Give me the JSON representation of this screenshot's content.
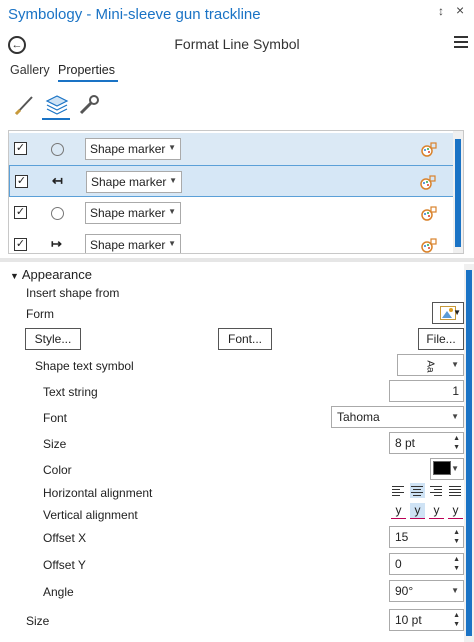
{
  "window": {
    "title": "Symbology - Mini-sleeve gun trackline",
    "pin_glyph": "↕",
    "close_glyph": "×"
  },
  "header": {
    "title": "Format Line Symbol",
    "back_glyph": "←"
  },
  "tabs": {
    "gallery": "Gallery",
    "properties": "Properties"
  },
  "layers": [
    {
      "checked": true,
      "marker_kind": "circle",
      "type": "Shape marker",
      "state": "selected"
    },
    {
      "checked": true,
      "marker_kind": "tick",
      "marker_glyph": "↤",
      "type": "Shape marker",
      "state": "active"
    },
    {
      "checked": true,
      "marker_kind": "circle",
      "type": "Shape marker",
      "state": "normal"
    },
    {
      "checked": true,
      "marker_kind": "tick",
      "marker_glyph": "↦",
      "type": "Shape marker",
      "state": "normal"
    }
  ],
  "appearance": {
    "section_title": "Appearance",
    "insert_shape_from": "Insert shape from",
    "form_label": "Form",
    "style_btn": "Style...",
    "font_btn": "Font...",
    "file_btn": "File...",
    "shape_text_symbol": "Shape text symbol",
    "shape_text_value": "Aa",
    "text_string_label": "Text string",
    "text_string_value": "1",
    "font_label": "Font",
    "font_value": "Tahoma",
    "size_label": "Size",
    "size_value": "8 pt",
    "color_label": "Color",
    "color_value": "#000000",
    "halign_label": "Horizontal alignment",
    "valign_label": "Vertical alignment",
    "valign_glyph": "y",
    "offset_x_label": "Offset X",
    "offset_x_value": "15",
    "offset_y_label": "Offset Y",
    "offset_y_value": "0",
    "angle_label": "Angle",
    "angle_value": "90°",
    "outer_size_label": "Size",
    "outer_size_value": "10 pt"
  },
  "colors": {
    "accent": "#1a73c5",
    "selected_row": "#dbe9f5"
  }
}
